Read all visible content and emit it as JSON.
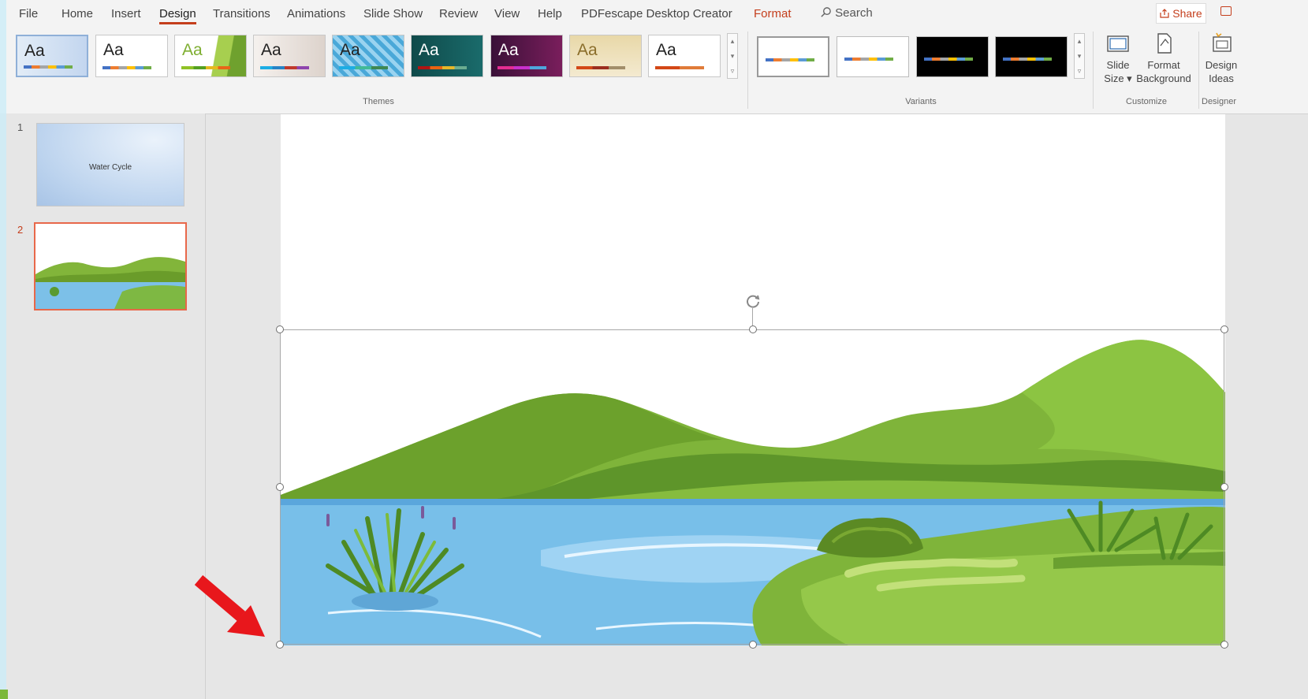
{
  "tabs": [
    "File",
    "Home",
    "Insert",
    "Design",
    "Transitions",
    "Animations",
    "Slide Show",
    "Review",
    "View",
    "Help",
    "PDFescape Desktop Creator",
    "Format"
  ],
  "search": {
    "label": "Search"
  },
  "share": {
    "label": "Share"
  },
  "ribbon": {
    "theme_aa": "Aa",
    "themes_label": "Themes",
    "variants_label": "Variants",
    "customize_label": "Customize",
    "designer_label": "Designer",
    "slide_size": {
      "line1": "Slide",
      "line2": "Size ▾"
    },
    "format_background": {
      "line1": "Format",
      "line2": "Background"
    },
    "design_ideas": {
      "line1": "Design",
      "line2": "Ideas"
    }
  },
  "slides": [
    {
      "number": "1",
      "title": "Water Cycle"
    },
    {
      "number": "2",
      "title": ""
    }
  ],
  "colors": {
    "accent": "#c43e1c",
    "arrow": "#e8171c",
    "selection_border": "#e8684a"
  }
}
